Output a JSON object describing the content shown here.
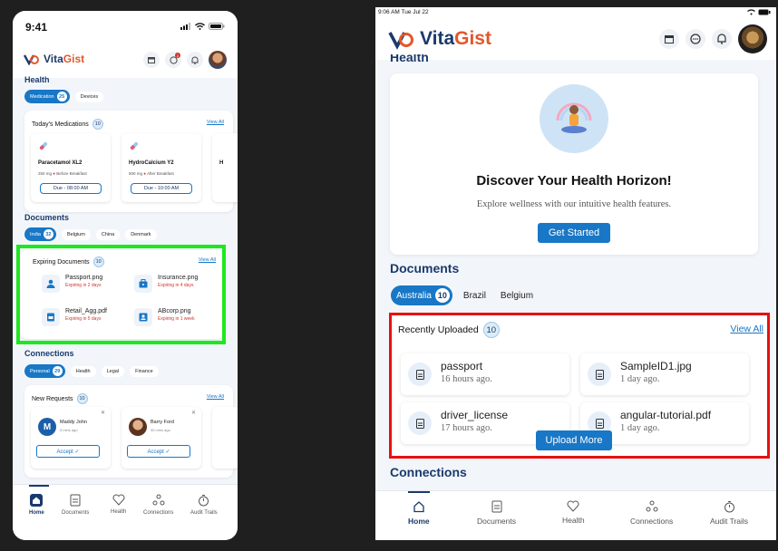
{
  "phone": {
    "time": "9:41",
    "app_name_1": "Vita",
    "app_name_2": "Gist",
    "notif_count": "2",
    "health": {
      "title": "Health",
      "chips": [
        {
          "label": "Medication",
          "count": "25"
        },
        {
          "label": "Devices"
        }
      ],
      "today_title": "Today's Medications",
      "today_count": "10",
      "view_all": "View All",
      "meds": [
        {
          "name": "Paracetamol XL2",
          "dose": "250 mg",
          "timing": "Before Breakfast",
          "due": "Due - 08:00 AM"
        },
        {
          "name": "HydroCalcium Y2",
          "dose": "500 mg",
          "timing": "After Breakfast",
          "due": "Due - 10:00 AM"
        },
        {
          "name": "H"
        }
      ]
    },
    "documents": {
      "title": "Documents",
      "chips": [
        {
          "label": "India",
          "count": "32"
        },
        {
          "label": "Belgium"
        },
        {
          "label": "China"
        },
        {
          "label": "Denmark"
        }
      ],
      "expiring_title": "Expiring Documents",
      "expiring_count": "10",
      "view_all": "View All",
      "items": [
        {
          "name": "Passport.png",
          "expiry": "Expiring in 2 days",
          "icon": "user-icon"
        },
        {
          "name": "Insurance.png",
          "expiry": "Expiring in 4 days",
          "icon": "briefcase-icon"
        },
        {
          "name": "Retail_Agg.pdf",
          "expiry": "Expiring in 5 days",
          "icon": "document-icon"
        },
        {
          "name": "ABcorp.png",
          "expiry": "Expiring in 1 week",
          "icon": "id-card-icon"
        }
      ]
    },
    "connections": {
      "title": "Connections",
      "chips": [
        {
          "label": "Personal",
          "count": "29"
        },
        {
          "label": "Health"
        },
        {
          "label": "Legal"
        },
        {
          "label": "Finance"
        }
      ],
      "requests_title": "New Requests",
      "requests_count": "10",
      "view_all": "View All",
      "requests": [
        {
          "initial": "M",
          "name": "Maddy John",
          "ago": "5 mins ago",
          "accept": "Accept ✓"
        },
        {
          "name": "Barry Ford",
          "ago": "35 mins ago",
          "accept": "Accept ✓"
        }
      ]
    },
    "nav": [
      "Home",
      "Documents",
      "Health",
      "Connections",
      "Audit Trails"
    ]
  },
  "tablet": {
    "status": "9:06 AM  Tue Jul 22",
    "app_name_1": "Vita",
    "app_name_2": "Gist",
    "partial_heading": "Health",
    "hero": {
      "title": "Discover Your Health Horizon!",
      "subtitle": "Explore wellness with our intuitive health features.",
      "cta": "Get Started"
    },
    "documents": {
      "title": "Documents",
      "chips": [
        {
          "label": "Australia",
          "count": "10"
        },
        {
          "label": "Brazil"
        },
        {
          "label": "Belgium"
        }
      ],
      "recent_title": "Recently Uploaded",
      "recent_count": "10",
      "view_all": "View All",
      "files": [
        {
          "name": "passport",
          "ago": "16 hours ago."
        },
        {
          "name": "SampleID1.jpg",
          "ago": "1 day ago."
        },
        {
          "name": "driver_license",
          "ago": "17 hours ago."
        },
        {
          "name": "angular-tutorial.pdf",
          "ago": "1 day ago."
        }
      ],
      "upload_more": "Upload More"
    },
    "connections_title": "Connections",
    "nav": [
      "Home",
      "Documents",
      "Health",
      "Connections",
      "Audit Trails"
    ]
  },
  "colors": {
    "navy": "#1b3a6b",
    "accent": "#1877c6",
    "brand_orange": "#e2572c",
    "green_highlight": "#1ee81e",
    "red_highlight": "#e81010"
  }
}
